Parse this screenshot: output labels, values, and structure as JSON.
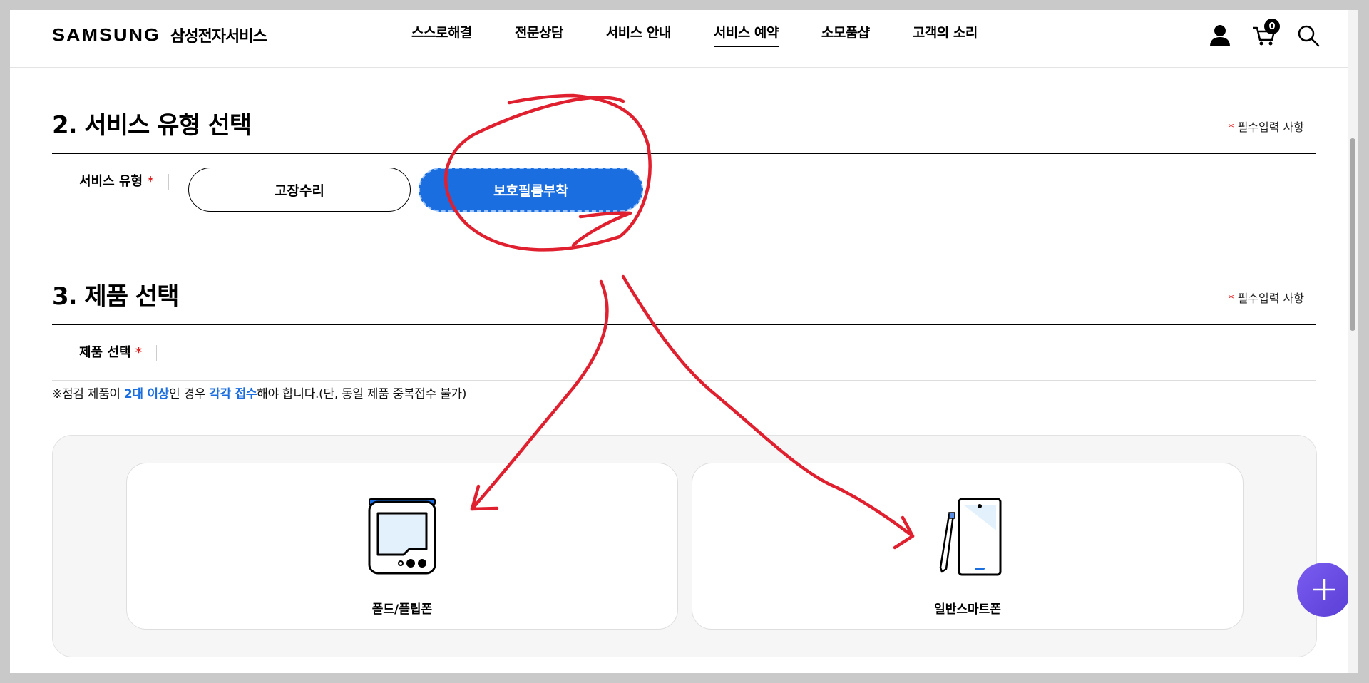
{
  "header": {
    "logo_wordmark": "SAMSUNG",
    "logo_service": "삼성전자서비스",
    "nav": [
      {
        "label": "스스로해결"
      },
      {
        "label": "전문상담"
      },
      {
        "label": "서비스 안내"
      },
      {
        "label": "서비스 예약",
        "active": true
      },
      {
        "label": "소모품샵"
      },
      {
        "label": "고객의 소리"
      }
    ],
    "cart_count": "0",
    "icons": [
      "user-icon",
      "cart-icon",
      "search-icon"
    ]
  },
  "section2": {
    "title": "2. 서비스 유형 선택",
    "required_star": "*",
    "required_note": " 필수입력 사항",
    "field_label": "서비스 유형",
    "field_star": "*",
    "options": [
      {
        "label": "고장수리",
        "selected": false
      },
      {
        "label": "보호필름부착",
        "selected": true
      }
    ]
  },
  "section3": {
    "title": "3. 제품 선택",
    "required_star": "*",
    "required_note": " 필수입력 사항",
    "field_label": "제품 선택",
    "field_star": "*",
    "notice_pre": "※점검 제품이 ",
    "notice_hl1": "2대 이상",
    "notice_mid": "인 경우 ",
    "notice_hl2": "각각 접수",
    "notice_post": "해야 합니다.(단, 동일 제품 중복접수 불가)",
    "products": [
      {
        "label": "폴드/플립폰",
        "icon": "foldable-phone-icon"
      },
      {
        "label": "일반스마트폰",
        "icon": "smartphone-icon"
      }
    ]
  },
  "colors": {
    "brand_blue": "#1a6ee0",
    "annotation_red": "#e0202f",
    "fab_purple": "#6a4de6"
  }
}
